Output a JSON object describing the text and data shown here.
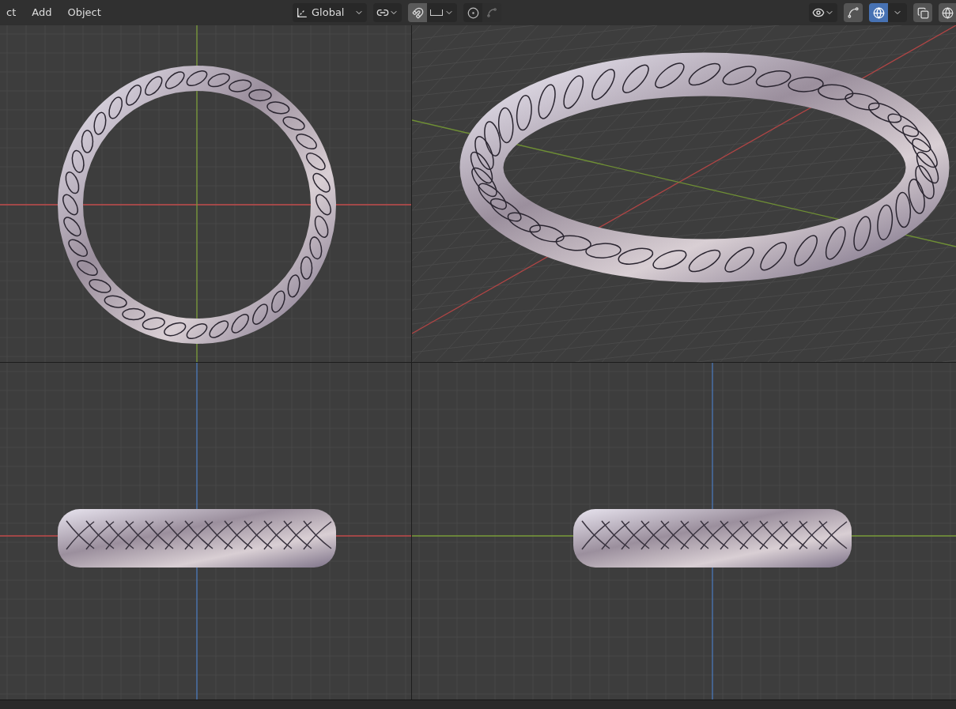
{
  "menu": [
    "ct",
    "Add",
    "Object"
  ],
  "toolbar": {
    "orientation": "Global",
    "snap": {
      "on": true
    },
    "proportional_editing": {
      "on": false
    },
    "overlays": {
      "on": true
    }
  },
  "viewports": [
    {
      "kind": "top"
    },
    {
      "kind": "perspective"
    },
    {
      "kind": "front"
    },
    {
      "kind": "right"
    }
  ]
}
